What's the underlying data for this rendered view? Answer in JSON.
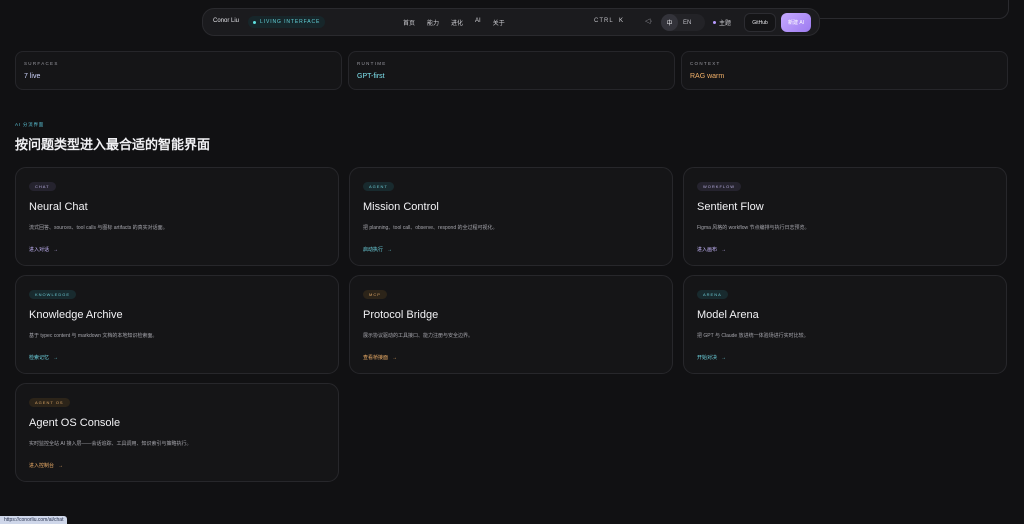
{
  "nav": {
    "brand": "Conor Liu",
    "live_label": "LIVING INTERFACE",
    "links": [
      "首页",
      "能力",
      "进化",
      "AI",
      "关于"
    ],
    "ctrl": "CTRL",
    "k": "K",
    "sound_icon": "◁·",
    "lang_active": "中",
    "lang_other": "EN",
    "theme": "主题",
    "github": "GitHub",
    "new_ai": "新建 AI"
  },
  "stats": [
    {
      "label": "SURFACES",
      "value": "7 live",
      "color": "#cfd6ff"
    },
    {
      "label": "RUNTIME",
      "value": "GPT-first",
      "color": "#7fe3ef"
    },
    {
      "label": "CONTEXT",
      "value": "RAG warm",
      "color": "#f2b169"
    }
  ],
  "section": {
    "eyebrow": "AI 分流界面",
    "title": "按问题类型进入最合适的智能界面"
  },
  "cards": [
    {
      "tag": "CHAT",
      "title": "Neural Chat",
      "desc": "流式回答、sources、tool calls 与图标 artifacts 的真实对话面。",
      "cta": "进入对话",
      "accent": "#c9b9ff",
      "tag_bg": "#25232e",
      "tag_color": "#b8aee0"
    },
    {
      "tag": "AGENT",
      "title": "Mission Control",
      "desc": "把 planning、tool call、observe、respond 的全过程可视化。",
      "cta": "启动执行",
      "accent": "#6fd9e6",
      "tag_bg": "#182a2e",
      "tag_color": "#6cc9d3"
    },
    {
      "tag": "WORKFLOW",
      "title": "Sentient Flow",
      "desc": "Figma 风格的 workflow 节点编排与执行日志预览。",
      "cta": "进入画布",
      "accent": "#c9b9ff",
      "tag_bg": "#25232e",
      "tag_color": "#b8aee0"
    },
    {
      "tag": "KNOWLEDGE",
      "title": "Knowledge Archive",
      "desc": "基于 typec content 与 markdown 文档的本地知识检索面。",
      "cta": "检索记忆",
      "accent": "#6fd9e6",
      "tag_bg": "#182a2e",
      "tag_color": "#6cc9d3"
    },
    {
      "tag": "MCP",
      "title": "Protocol Bridge",
      "desc": "展示协议驱动的工具接口、能力注册与安全边界。",
      "cta": "查看桥接面",
      "accent": "#f2b169",
      "tag_bg": "#2c2419",
      "tag_color": "#d8a466"
    },
    {
      "tag": "ARENA",
      "title": "Model Arena",
      "desc": "把 GPT 与 Claude 放进统一体验场进行实时比较。",
      "cta": "开始对决",
      "accent": "#6fd9e6",
      "tag_bg": "#182a2e",
      "tag_color": "#6cc9d3"
    },
    {
      "tag": "AGENT OS",
      "title": "Agent OS Console",
      "desc": "实时监控全站 AI 接入层——会话追踪、工具调用、知识索引与策略执行。",
      "cta": "进入控制台",
      "accent": "#f2b169",
      "tag_bg": "#2c2419",
      "tag_color": "#d8a466"
    }
  ],
  "status_url": "https://conorliu.com/ai/chat"
}
